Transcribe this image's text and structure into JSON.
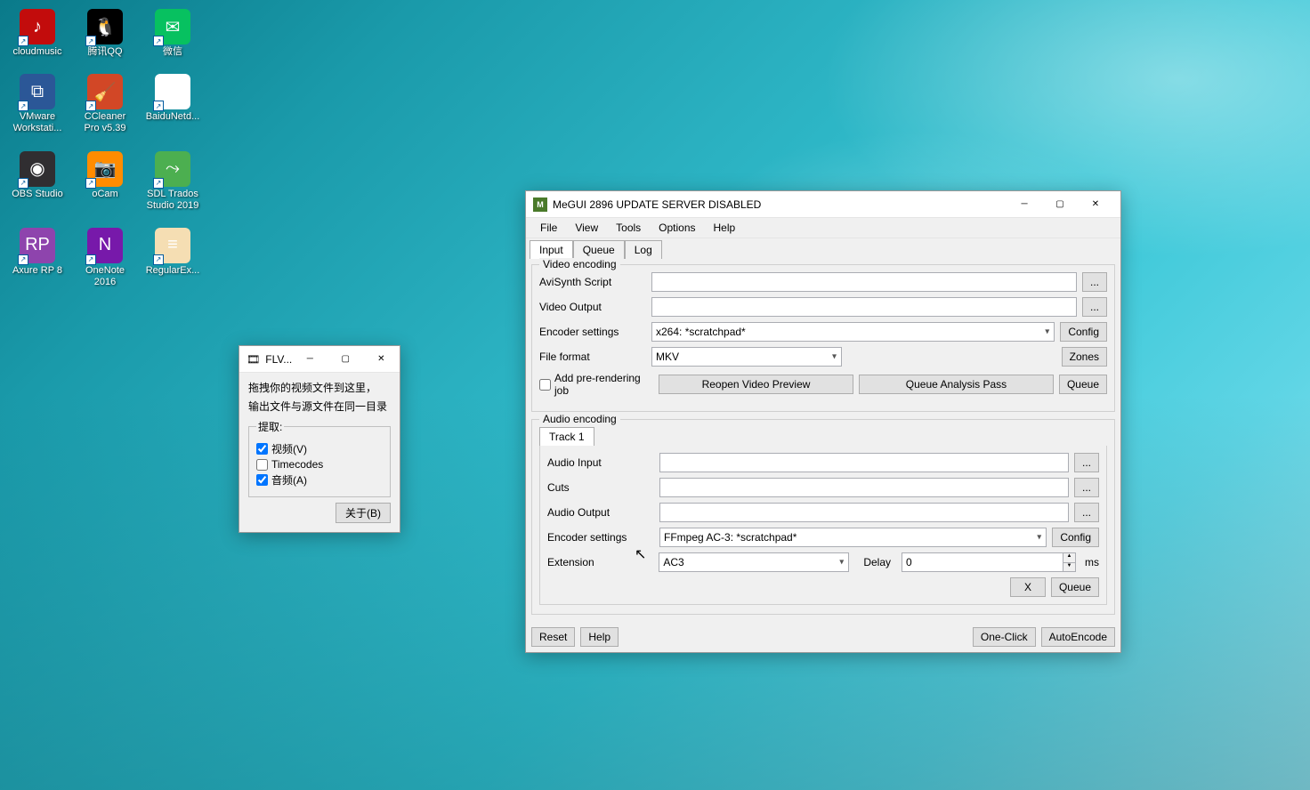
{
  "desktop": {
    "icons": [
      [
        {
          "label": "cloudmusic",
          "color": "#c20c0c",
          "glyph": "♪"
        },
        {
          "label": "腾讯QQ",
          "color": "#000",
          "glyph": "🐧"
        },
        {
          "label": "微信",
          "color": "#07c160",
          "glyph": "✉"
        }
      ],
      [
        {
          "label": "VMware\nWorkstati...",
          "color": "#2b5797",
          "glyph": "⧉"
        },
        {
          "label": "CCleaner\nPro v5.39",
          "color": "#d24726",
          "glyph": "🧹"
        },
        {
          "label": "BaiduNetd...",
          "color": "#fff",
          "glyph": "☁"
        }
      ],
      [
        {
          "label": "OBS Studio",
          "color": "#302e31",
          "glyph": "◉"
        },
        {
          "label": "oCam",
          "color": "#ff8c00",
          "glyph": "📷"
        },
        {
          "label": "SDL Trados\nStudio 2019",
          "color": "#4caf50",
          "glyph": "⤳"
        }
      ],
      [
        {
          "label": "Axure RP 8",
          "color": "#8e44ad",
          "glyph": "RP"
        },
        {
          "label": "OneNote\n2016",
          "color": "#7719aa",
          "glyph": "N"
        },
        {
          "label": "RegularEx...",
          "color": "#f5deb3",
          "glyph": "≡"
        }
      ]
    ]
  },
  "flv": {
    "title": "FLV...",
    "line1": "拖拽你的视频文件到这里，",
    "line2": "输出文件与源文件在同一目录",
    "fieldset_legend": "提取:",
    "cb_video": "视频(V)",
    "cb_timecodes": "Timecodes",
    "cb_audio": "音频(A)",
    "cb_video_checked": true,
    "cb_timecodes_checked": false,
    "cb_audio_checked": true,
    "about_btn": "关于(B)"
  },
  "megui": {
    "title": "MeGUI 2896 UPDATE SERVER DISABLED",
    "menu": {
      "file": "File",
      "view": "View",
      "tools": "Tools",
      "options": "Options",
      "help": "Help"
    },
    "tabs": {
      "input": "Input",
      "queue": "Queue",
      "log": "Log"
    },
    "video": {
      "group_title": "Video encoding",
      "avisynth_label": "AviSynth Script",
      "avisynth_value": "",
      "output_label": "Video Output",
      "output_value": "",
      "encoder_label": "Encoder settings",
      "encoder_value": "x264: *scratchpad*",
      "config_btn": "Config",
      "format_label": "File format",
      "format_value": "MKV",
      "zones_btn": "Zones",
      "addprerender_label": "Add pre-rendering job",
      "reopen_btn": "Reopen Video Preview",
      "analysis_btn": "Queue Analysis Pass",
      "queue_btn": "Queue"
    },
    "audio": {
      "group_title": "Audio encoding",
      "track_tab": "Track 1",
      "input_label": "Audio Input",
      "input_value": "",
      "cuts_label": "Cuts",
      "cuts_value": "",
      "output_label": "Audio Output",
      "output_value": "",
      "encoder_label": "Encoder settings",
      "encoder_value": "FFmpeg AC-3: *scratchpad*",
      "config_btn": "Config",
      "extension_label": "Extension",
      "extension_value": "AC3",
      "delay_label": "Delay",
      "delay_value": "0",
      "ms_label": "ms",
      "x_btn": "X",
      "queue_btn": "Queue"
    },
    "bottom": {
      "reset_btn": "Reset",
      "help_btn": "Help",
      "oneclick_btn": "One-Click",
      "autoencode_btn": "AutoEncode"
    }
  }
}
